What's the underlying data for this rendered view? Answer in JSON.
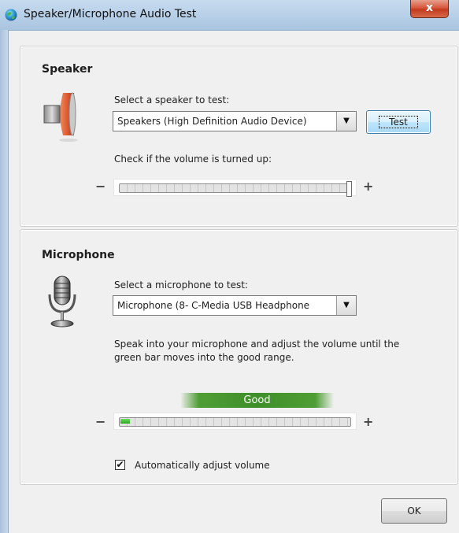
{
  "window": {
    "title": "Speaker/Microphone Audio Test",
    "close_glyph": "x"
  },
  "speaker": {
    "heading": "Speaker",
    "select_label": "Select a speaker to test:",
    "selected_device": "Speakers (High Definition Audio Device)",
    "test_button": "Test",
    "volume_label": "Check if the volume is turned up:",
    "volume_level": 1.0,
    "minus": "−",
    "plus": "+"
  },
  "microphone": {
    "heading": "Microphone",
    "select_label": "Select a microphone to test:",
    "selected_device": "Microphone (8- C-Media USB Headphone",
    "instructions_line1": "Speak into your microphone and adjust the volume until the",
    "instructions_line2": "green bar moves into the good range.",
    "good_label": "Good",
    "input_level": 0.04,
    "minus": "−",
    "plus": "+",
    "auto_adjust_label": "Automatically adjust volume",
    "auto_adjust_checked": true,
    "check_glyph": "✔"
  },
  "footer": {
    "ok_button": "OK"
  },
  "icons": {
    "title": "globe-icon",
    "speaker": "speaker-icon",
    "microphone": "microphone-icon",
    "dropdown": "chevron-down-icon"
  },
  "colors": {
    "good": "#3e8e2a",
    "speaker_icon": "#d8552c"
  }
}
